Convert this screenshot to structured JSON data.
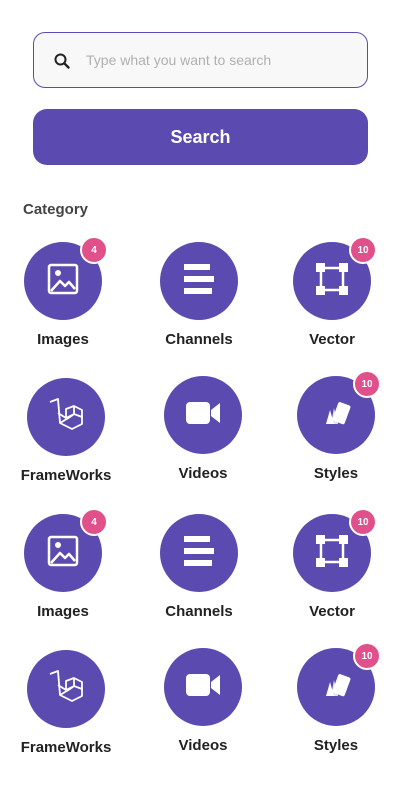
{
  "search": {
    "placeholder": "Type what you want to search",
    "button_label": "Search"
  },
  "category": {
    "title": "Category",
    "items": [
      {
        "label": "Images",
        "icon": "image-icon",
        "badge": "4"
      },
      {
        "label": "Channels",
        "icon": "channels-icon",
        "badge": ""
      },
      {
        "label": "Vector",
        "icon": "vector-icon",
        "badge": "10"
      },
      {
        "label": "FrameWorks",
        "icon": "laravel-icon",
        "badge": ""
      },
      {
        "label": "Videos",
        "icon": "video-camera-icon",
        "badge": ""
      },
      {
        "label": "Styles",
        "icon": "styles-icon",
        "badge": "10"
      },
      {
        "label": "Images",
        "icon": "image-icon",
        "badge": "4"
      },
      {
        "label": "Channels",
        "icon": "channels-icon",
        "badge": ""
      },
      {
        "label": "Vector",
        "icon": "vector-icon",
        "badge": "10"
      },
      {
        "label": "FrameWorks",
        "icon": "laravel-icon",
        "badge": ""
      },
      {
        "label": "Videos",
        "icon": "video-camera-icon",
        "badge": ""
      },
      {
        "label": "Styles",
        "icon": "styles-icon",
        "badge": "10"
      }
    ]
  },
  "colors": {
    "primary": "#5b4bb0",
    "badge": "#e0508a"
  }
}
